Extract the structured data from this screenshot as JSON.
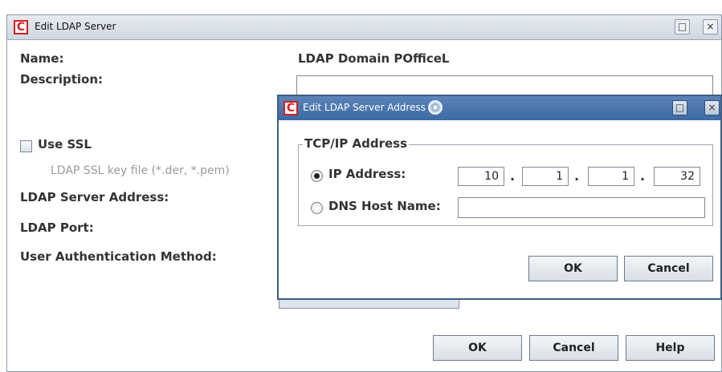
{
  "main_dialog": {
    "title": "Edit LDAP Server",
    "fields": {
      "name_label": "Name:",
      "name_value": "LDAP Domain POfficeL",
      "description_label": "Description:",
      "description_value": "",
      "use_ssl_label": "Use SSL",
      "use_ssl_checked": false,
      "ssl_key_label": "LDAP SSL key file (*.der, *.pem)",
      "server_address_label": "LDAP Server Address:",
      "port_label": "LDAP Port:",
      "auth_method_label": "User Authentication Method:"
    },
    "buttons": {
      "ok": "OK",
      "cancel": "Cancel",
      "help": "Help"
    }
  },
  "address_dialog": {
    "title": "Edit LDAP Server Address",
    "group_title": "TCP/IP Address",
    "ip_option_label": "IP Address:",
    "ip_selected": true,
    "ip_octets": [
      "10",
      "1",
      "1",
      "32"
    ],
    "dns_option_label": "DNS Host Name:",
    "dns_value": "",
    "buttons": {
      "ok": "OK",
      "cancel": "Cancel"
    }
  },
  "window_controls": {
    "maximize": "□",
    "close": "×"
  },
  "icons": {
    "app": "app-logo-icon",
    "cd": "cd-icon",
    "maximize": "maximize-icon",
    "close": "close-icon"
  },
  "colors": {
    "app_icon_red": "#d21f1f",
    "active_title": "#3c6aa3",
    "inactive_title": "#d6dde5"
  }
}
